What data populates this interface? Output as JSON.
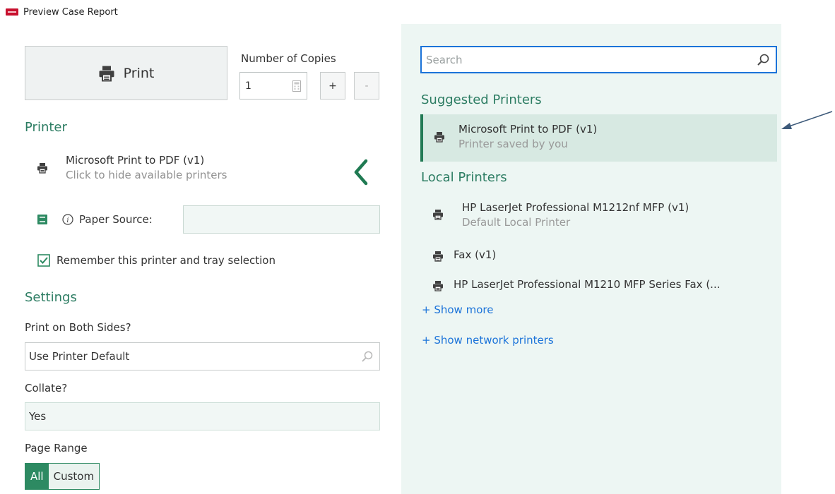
{
  "window": {
    "title": "Preview Case Report",
    "logo_color": "#c8102e"
  },
  "print_button": {
    "label": "Print",
    "icon": "printer-icon"
  },
  "copies": {
    "label": "Number of Copies",
    "value": "1",
    "plus": "+",
    "minus": "-"
  },
  "printer_section": {
    "heading": "Printer",
    "selected_name": "Microsoft Print to PDF (v1)",
    "selected_sub": "Click to hide available printers",
    "paper_source_label": "Paper Source:",
    "paper_source_value": "",
    "remember_label": "Remember this printer and tray selection",
    "remember_checked": true
  },
  "settings": {
    "heading": "Settings",
    "both_sides_label": "Print on Both Sides?",
    "both_sides_value": "Use Printer Default",
    "collate_label": "Collate?",
    "collate_value": "Yes",
    "page_range_label": "Page Range",
    "page_range_options": [
      "All",
      "Custom"
    ],
    "page_range_selected": "All"
  },
  "printer_list": {
    "search_placeholder": "Search",
    "suggested_heading": "Suggested Printers",
    "suggested": [
      {
        "name": "Microsoft Print to PDF (v1)",
        "sub": "Printer saved by you"
      }
    ],
    "local_heading": "Local Printers",
    "local": [
      {
        "name": "HP LaserJet Professional M1212nf MFP (v1)",
        "sub": "Default Local Printer"
      },
      {
        "name": "Fax (v1)",
        "sub": ""
      },
      {
        "name": "HP LaserJet Professional M1210 MFP Series Fax (...",
        "sub": ""
      }
    ],
    "show_more": "+ Show more",
    "show_network": "+ Show network printers"
  },
  "colors": {
    "accent_green": "#2d7d63",
    "selected_bg": "#d7e9e2",
    "panel_bg": "#edf6f3",
    "link_blue": "#1b73d9"
  }
}
